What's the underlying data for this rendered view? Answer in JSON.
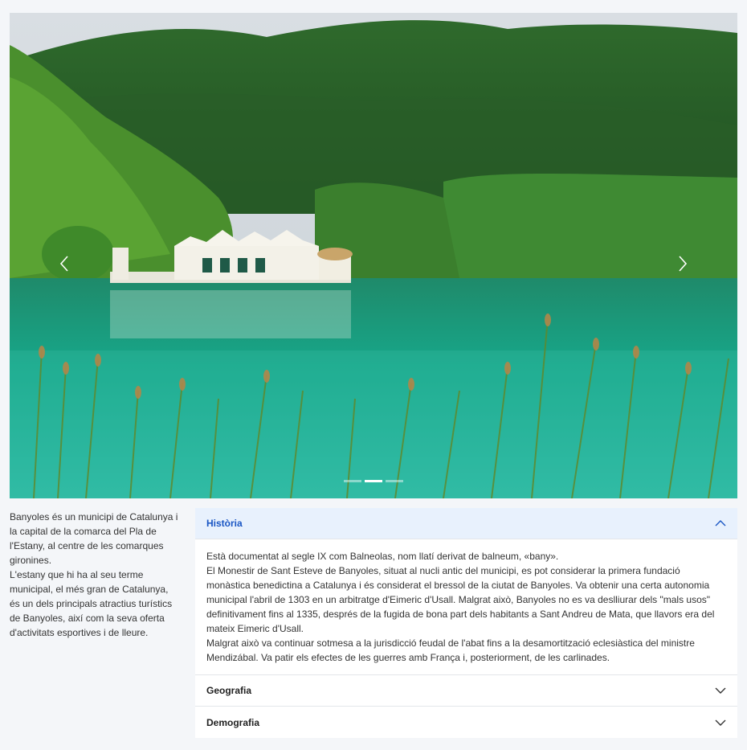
{
  "carousel": {
    "image_alt": "Banyoles lake with Caseta de Banys and green hills",
    "prev_icon": "chevron-left-icon",
    "next_icon": "chevron-right-icon",
    "slide_count": 3,
    "active_slide": 2
  },
  "intro": {
    "paragraph1": "Banyoles és un municipi de Catalunya i la capital de la comarca del Pla de l'Estany, al centre de les comarques gironines.",
    "paragraph2": "L'estany que hi ha al seu terme municipal, el més gran de Catalunya, és un dels principals atractius turístics de Banyoles, així com la seva oferta d'activitats esportives i de lleure."
  },
  "accordion": {
    "sections": [
      {
        "title": "Història",
        "expanded": true,
        "icon": "chevron-up-icon",
        "paragraphs": [
          "Està documentat al segle IX com Balneolas, nom llatí derivat de balneum, «bany».",
          "El Monestir de Sant Esteve de Banyoles, situat al nucli antic del municipi, es pot considerar la primera fundació monàstica benedictina a Catalunya i és considerat el bressol de la ciutat de Banyoles. Va obtenir una certa autonomia municipal l'abril de 1303 en un arbitratge d'Eimeric d'Usall. Malgrat això, Banyoles no es va deslliurar dels \"mals usos\" definitivament fins al 1335, després de la fugida de bona part dels habitants a Sant Andreu de Mata, que llavors era del mateix Eimeric d'Usall.",
          "Malgrat això va continuar sotmesa a la jurisdicció feudal de l'abat fins a la desamortització eclesiàstica del ministre Mendizábal. Va patir els efectes de les guerres amb França i, posteriorment, de les carlinades."
        ]
      },
      {
        "title": "Geografia",
        "expanded": false,
        "icon": "chevron-down-icon"
      },
      {
        "title": "Demografia",
        "expanded": false,
        "icon": "chevron-down-icon"
      }
    ]
  },
  "colors": {
    "accent": "#1a56c4",
    "open_header_bg": "#e8f1fd",
    "page_bg": "#f4f6f9"
  }
}
